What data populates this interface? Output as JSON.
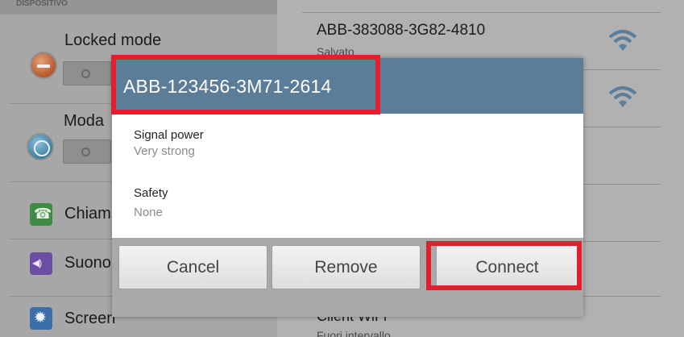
{
  "background": {
    "section_header": "DISPOSITIVO",
    "settings": [
      {
        "label": "Locked mode",
        "icon": "locked-mode-icon",
        "toggle": "off"
      },
      {
        "label": "Moda",
        "icon": "driving-mode-icon",
        "toggle": "off"
      },
      {
        "label": "Chiam",
        "icon": "call-icon"
      },
      {
        "label": "Suono",
        "icon": "sound-icon"
      },
      {
        "label": "Screen",
        "icon": "screen-icon"
      }
    ],
    "wifi_networks": [
      {
        "name": "ABB-383088-3G82-4810",
        "status": "Salvato"
      },
      {
        "name": "Client WiFi",
        "status": "Fuori intervallo"
      }
    ]
  },
  "dialog": {
    "title": "ABB-123456-3M71-2614",
    "fields": [
      {
        "label": "Signal power",
        "value": "Very strong"
      },
      {
        "label": "Safety",
        "value": "None"
      }
    ],
    "buttons": {
      "cancel": "Cancel",
      "remove": "Remove",
      "connect": "Connect"
    }
  },
  "colors": {
    "highlight": "#e31e2e",
    "title_bar": "#5c7d98",
    "wifi_icon": "#5b7e9b"
  }
}
